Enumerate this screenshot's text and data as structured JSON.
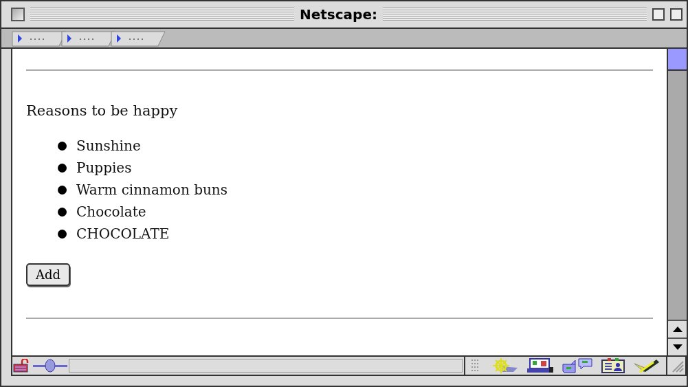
{
  "window": {
    "title": "Netscape:"
  },
  "page": {
    "heading": "Reasons to be happy",
    "items": [
      "Sunshine",
      "Puppies",
      "Warm cinnamon buns",
      "Chocolate",
      "CHOCOLATE"
    ],
    "button": "Add"
  }
}
